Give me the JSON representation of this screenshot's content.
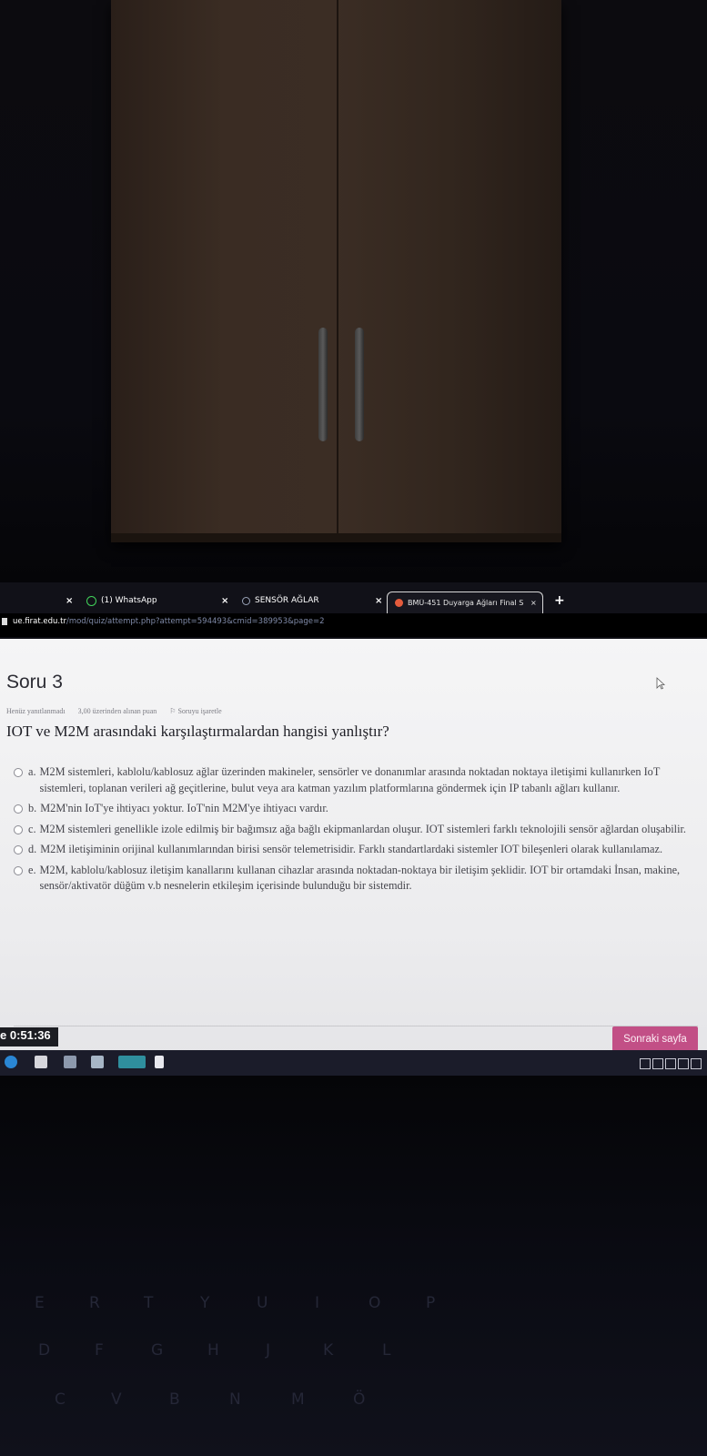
{
  "browser": {
    "tabs": [
      {
        "label": "(1) WhatsApp",
        "icon": "whatsapp-icon"
      },
      {
        "label": "SENSÖR AĞLAR",
        "icon": "globe-icon"
      },
      {
        "label": "BMÜ-451 Duyarga Ağları Final S",
        "icon": "moodle-icon",
        "active": true
      }
    ],
    "new_tab": "+",
    "close_glyph": "×",
    "url_host": "ue.firat.edu.tr",
    "url_path": "/mod/quiz/attempt.php?attempt=594493&cmid=389953&page=2"
  },
  "quiz": {
    "question_title": "Soru 3",
    "status": "Henüz yanıtlanmadı",
    "points": "3,00 üzerinden alınan puan",
    "flag": "Soruyu işaretle",
    "question_text": "IOT ve M2M arasındaki karşılaştırmalardan hangisi yanlıştır?",
    "options": [
      {
        "letter": "a.",
        "text": "M2M sistemleri, kablolu/kablosuz ağlar üzerinden makineler, sensörler ve donanımlar arasında noktadan noktaya iletişimi kullanırken IoT sistemleri, toplanan verileri ağ geçitlerine, bulut veya ara katman yazılım platformlarına göndermek için IP tabanlı ağları kullanır."
      },
      {
        "letter": "b.",
        "text": "M2M'nin IoT'ye ihtiyacı yoktur. IoT'nin M2M'ye ihtiyacı vardır."
      },
      {
        "letter": "c.",
        "text": "M2M sistemleri genellikle izole edilmiş bir bağımsız ağa bağlı ekipmanlardan oluşur. IOT sistemleri farklı teknolojili sensör ağlardan oluşabilir."
      },
      {
        "letter": "d.",
        "text": "M2M iletişiminin orijinal kullanımlarından birisi sensör telemetrisidir. Farklı standartlardaki sistemler IOT bileşenleri olarak kullanılamaz."
      },
      {
        "letter": "e.",
        "text": "M2M, kablolu/kablosuz iletişim kanallarını kullanan cihazlar arasında noktadan-noktaya bir iletişim şeklidir. IOT bir ortamdaki İnsan, makine, sensör/aktivatör düğüm v.b nesnelerin etkileşim içerisinde bulunduğu bir sistemdir."
      }
    ],
    "timer": "e 0:51:36",
    "next_button": "Sonraki sayfa"
  },
  "keyboard_keys": [
    "E",
    "R",
    "T",
    "Y",
    "U",
    "I",
    "O",
    "P",
    "D",
    "F",
    "G",
    "H",
    "J",
    "K",
    "L",
    "C",
    "V",
    "B",
    "N",
    "M",
    "Ö"
  ],
  "colors": {
    "next_button": "#c24f86",
    "cabinet": "#3a2c23",
    "page_bg": "#f0f0f2"
  }
}
